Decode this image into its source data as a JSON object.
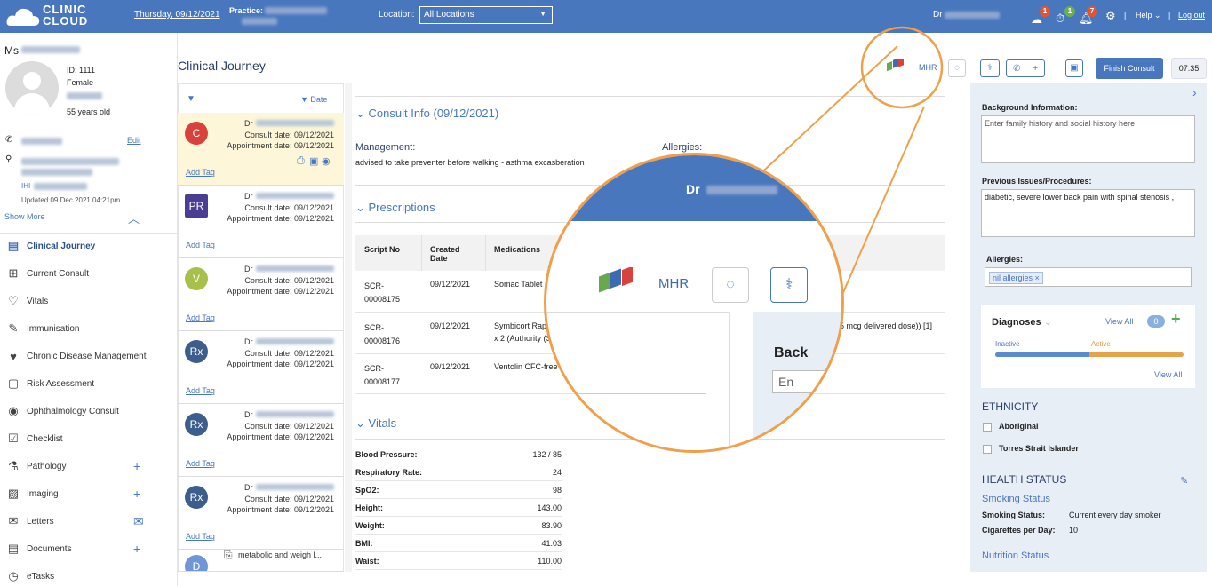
{
  "topbar": {
    "logo_text": "CLINIC CLOUD",
    "date": "Thursday, 09/12/2021",
    "practice_label": "Practice:",
    "location_label": "Location:",
    "location_value": "All Locations",
    "doctor_prefix": "Dr",
    "badge_counts": [
      "1",
      "1",
      "7"
    ],
    "help_label": "Help",
    "logout_label": "Log out"
  },
  "patient": {
    "title": "Ms",
    "id": "ID: 1111",
    "sex": "Female",
    "age": "55 years old",
    "edit_label": "Edit",
    "ihi_label": "IHI",
    "updated": "Updated 09 Dec 2021 04:21pm",
    "show_more": "Show More"
  },
  "nav": {
    "items": [
      {
        "label": "Clinical Journey",
        "icon": "clinical-journey-icon",
        "active": true
      },
      {
        "label": "Current Consult",
        "icon": "consult-icon"
      },
      {
        "label": "Vitals",
        "icon": "heart-icon"
      },
      {
        "label": "Immunisation",
        "icon": "syringe-icon"
      },
      {
        "label": "Chronic Disease Management",
        "icon": "heartbeat-icon"
      },
      {
        "label": "Risk Assessment",
        "icon": "risk-icon"
      },
      {
        "label": "Ophthalmology Consult",
        "icon": "eye-icon"
      },
      {
        "label": "Checklist",
        "icon": "checklist-icon"
      },
      {
        "label": "Pathology",
        "icon": "microscope-icon",
        "plus": true
      },
      {
        "label": "Imaging",
        "icon": "image-icon",
        "plus": true
      },
      {
        "label": "Letters",
        "icon": "envelope-icon",
        "mail": true
      },
      {
        "label": "Documents",
        "icon": "document-icon",
        "plus": true
      },
      {
        "label": "eTasks",
        "icon": "clock-icon"
      }
    ]
  },
  "page_title": "Clinical Journey",
  "header_actions": {
    "mhr": "MHR",
    "finish_consult": "Finish Consult",
    "time": "07:35"
  },
  "journey": {
    "sort_label": "▼ Date",
    "dr_prefix": "Dr",
    "consult_date": "Consult date: 09/12/2021",
    "appointment_date": "Appointment date: 09/12/2021",
    "add_tag": "Add Tag",
    "cards": [
      {
        "initials": "C",
        "color": "#d9413c"
      },
      {
        "initials": "PR",
        "color": "#4a3d93"
      },
      {
        "initials": "V",
        "color": "#a7c04a"
      },
      {
        "initials": "Rx",
        "color": "#3d5d8c"
      },
      {
        "initials": "Rx",
        "color": "#3d5d8c"
      },
      {
        "initials": "Rx",
        "color": "#3d5d8c"
      }
    ],
    "last_card": {
      "initials": "D",
      "color": "#6f96d6",
      "file_text": "metabolic and weigh l..."
    }
  },
  "consult_info": {
    "title": "Consult Info (09/12/2021)",
    "management_label": "Management:",
    "management_text": "advised to take preventer before walking - asthma excasberation",
    "allergies_label": "Allergies:"
  },
  "prescriptions": {
    "title": "Prescriptions",
    "headers": [
      "Script No",
      "Created Date",
      "Medications"
    ],
    "rows": [
      {
        "script": "SCR-00008175",
        "date": "09/12/2021",
        "med": "Somac Tablet"
      },
      {
        "script": "SCR-00008176",
        "date": "09/12/2021",
        "med": "Symbicort Rap",
        "med2": "x 2 (Authority (S",
        "tail": "g 4.5 mcg delivered dose)) [1]"
      },
      {
        "script": "SCR-00008177",
        "date": "09/12/2021",
        "med": "Ventolin CFC-free"
      }
    ]
  },
  "vitals": {
    "title": "Vitals",
    "rows": [
      {
        "label": "Blood Pressure:",
        "value": "132 / 85"
      },
      {
        "label": "Respiratory Rate:",
        "value": "24"
      },
      {
        "label": "SpO2:",
        "value": "98"
      },
      {
        "label": "Height:",
        "value": "143.00"
      },
      {
        "label": "Weight:",
        "value": "83.90"
      },
      {
        "label": "BMI:",
        "value": "41.03"
      },
      {
        "label": "Waist:",
        "value": "110.00"
      }
    ]
  },
  "magnifier": {
    "dr_prefix": "Dr",
    "mhr": "MHR",
    "back_text": "Back",
    "input_text": "En"
  },
  "right_panel": {
    "background_label": "Background Information:",
    "background_placeholder": "Enter family history and social history here",
    "previous_label": "Previous Issues/Procedures:",
    "previous_text": "diabetic, severe lower back pain with spinal stenosis ,",
    "allergies_label": "Allergies:",
    "allergy_tag": "nil allergies",
    "diagnoses_label": "Diagnoses",
    "view_all": "View All",
    "diagnoses_count": "0",
    "inactive_label": "Inactive",
    "active_label": "Active",
    "view_all_2": "View All",
    "inactive_fraction": 0.5,
    "ethnicity_title": "ETHNICITY",
    "aboriginal": "Aboriginal",
    "torres": "Torres Strait Islander",
    "health_title": "HEALTH STATUS",
    "smoking_title": "Smoking Status",
    "smoking_label": "Smoking Status:",
    "smoking_value": "Current every day smoker",
    "cigs_label": "Cigarettes per Day:",
    "cigs_value": "10",
    "nutrition_title": "Nutrition Status"
  },
  "colors": {
    "brand": "#4877be",
    "accent": "#f0a04b",
    "highlight": "#fdf6d8"
  }
}
